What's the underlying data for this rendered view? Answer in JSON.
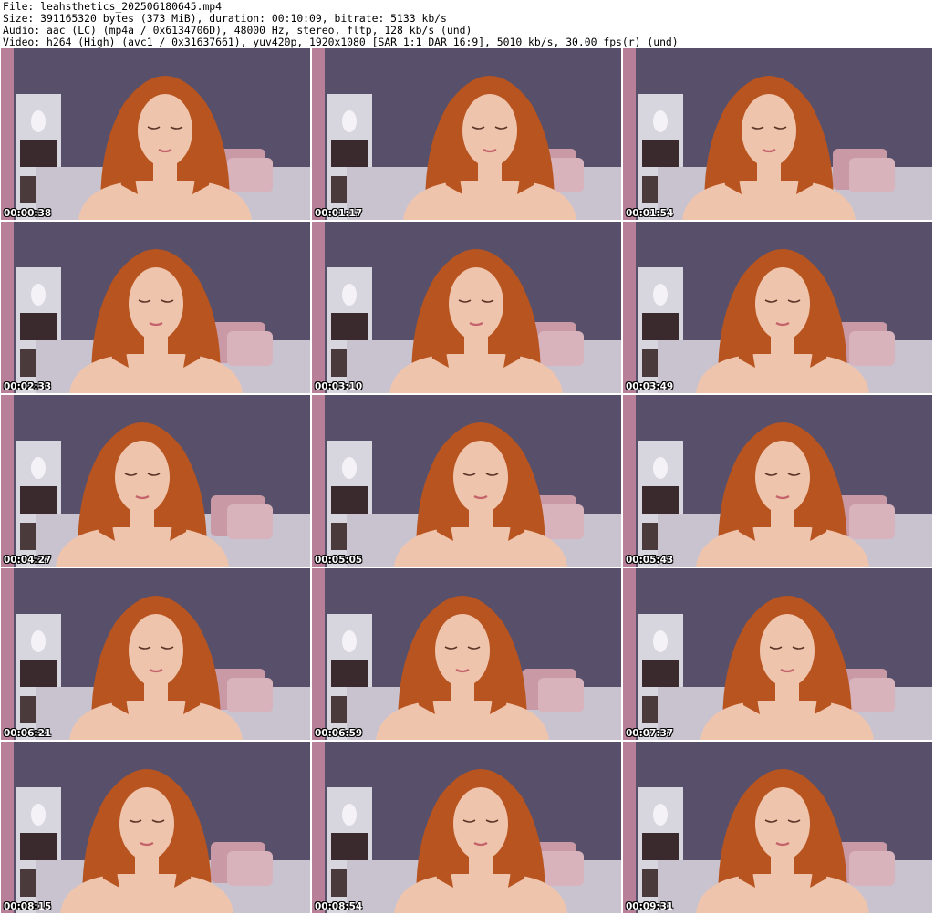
{
  "header": {
    "file_line": "File: leahsthetics_202506180645.mp4",
    "size_line": "Size: 391165320 bytes (373 MiB), duration: 00:10:09, bitrate: 5133 kb/s",
    "audio_line": "Audio: aac (LC) (mp4a / 0x6134706D), 48000 Hz, stereo, fltp, 128 kb/s (und)",
    "video_line": "Video: h264 (High) (avc1 / 0x31637661), yuv420p, 1920x1080 [SAR 1:1 DAR 16:9], 5010 kb/s, 30.00 fps(r) (und)"
  },
  "thumbnails": [
    {
      "timestamp": "00:00:38"
    },
    {
      "timestamp": "00:01:17"
    },
    {
      "timestamp": "00:01:54"
    },
    {
      "timestamp": "00:02:33"
    },
    {
      "timestamp": "00:03:10"
    },
    {
      "timestamp": "00:03:49"
    },
    {
      "timestamp": "00:04:27"
    },
    {
      "timestamp": "00:05:05"
    },
    {
      "timestamp": "00:05:43"
    },
    {
      "timestamp": "00:06:21"
    },
    {
      "timestamp": "00:06:59"
    },
    {
      "timestamp": "00:07:37"
    },
    {
      "timestamp": "00:08:15"
    },
    {
      "timestamp": "00:08:54"
    },
    {
      "timestamp": "00:09:31"
    }
  ],
  "colors": {
    "wall": "#58506a",
    "shelf": "#e6e4ec",
    "curtain": "#b77f98",
    "bed": "#c9c3cf",
    "pillow": "#c99aa6",
    "hair": "#b8541f",
    "skin": "#efc4ad",
    "timestamp_text": "#ffffff"
  }
}
